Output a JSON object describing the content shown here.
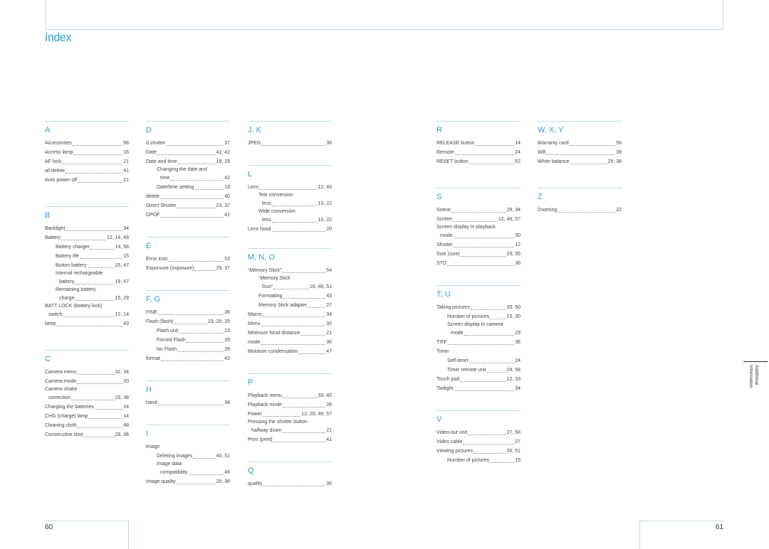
{
  "header": {
    "title": "Index"
  },
  "columns": [
    {
      "sections": [
        {
          "letter": "A",
          "entries": [
            {
              "label": "Accessories",
              "pages": "58"
            },
            {
              "label": "Access lamp",
              "pages": "16"
            },
            {
              "label": "AF lock",
              "pages": "21"
            },
            {
              "label": "all delete",
              "pages": "41"
            },
            {
              "label": "Auto power off",
              "pages": "21"
            }
          ]
        },
        {
          "letter": "B",
          "entries": [
            {
              "label": "Backlight",
              "pages": "34"
            },
            {
              "label": "Battery",
              "pages": "12, 14, 49"
            },
            {
              "label": "Battery charger",
              "pages": "14, 58",
              "sub": true
            },
            {
              "label": "Battery life",
              "pages": "15",
              "sub": true
            },
            {
              "label": "Button battery",
              "pages": "25, 47",
              "sub": true
            },
            {
              "label": "Internal rechargeable",
              "cont": "battery",
              "pages": "19, 47",
              "sub": true
            },
            {
              "label": "Remaining battery",
              "cont": "charge",
              "pages": "15, 29",
              "sub": true
            },
            {
              "label": "BATT LOCK (battery lock)",
              "cont": "switch",
              "pages": "12, 14"
            },
            {
              "label": "beep",
              "pages": "43"
            }
          ]
        },
        {
          "letter": "C",
          "entries": [
            {
              "label": "Camera menu",
              "pages": "32, 34"
            },
            {
              "label": "Camera mode",
              "pages": "20"
            },
            {
              "label": "Camera shake",
              "cont": "correction",
              "pages": "29, 38"
            },
            {
              "label": "Charging the batteries",
              "pages": "14"
            },
            {
              "label": "CHG (charge) lamp",
              "pages": "14"
            },
            {
              "label": "Cleaning cloth",
              "pages": "48"
            },
            {
              "label": "Consecutive shot",
              "pages": "29, 36"
            }
          ]
        }
      ]
    },
    {
      "sections": [
        {
          "letter": "D",
          "entries": [
            {
              "label": "d.shutter",
              "pages": "37"
            },
            {
              "label": "Date",
              "pages": "41, 42"
            },
            {
              "label": "Date and time",
              "pages": "18, 29"
            },
            {
              "label": "Changing the date and",
              "cont": "time",
              "pages": "42",
              "sub": true
            },
            {
              "label": "Date/time setting",
              "pages": "19",
              "sub": true
            },
            {
              "label": "delete",
              "pages": "40"
            },
            {
              "label": "Direct Shutter",
              "pages": "23, 37"
            },
            {
              "label": "DPOF",
              "pages": "41"
            }
          ]
        },
        {
          "letter": "E",
          "entries": [
            {
              "label": "Error icon",
              "pages": "53"
            },
            {
              "label": "Exporsure (exposure)",
              "pages": "29, 37"
            }
          ]
        },
        {
          "letter": "F, G",
          "entries": [
            {
              "label": "FINE",
              "pages": "36"
            },
            {
              "label": "Flash (flash)",
              "pages": "23, 29, 35"
            },
            {
              "label": "Flash unit",
              "pages": "23",
              "sub": true
            },
            {
              "label": "Forced Flash",
              "pages": "35",
              "sub": true
            },
            {
              "label": "No Flash",
              "pages": "35",
              "sub": true
            },
            {
              "label": "format",
              "pages": "43"
            }
          ]
        },
        {
          "letter": "H",
          "entries": [
            {
              "label": "hand",
              "pages": "38"
            }
          ]
        },
        {
          "letter": "I",
          "entries": [
            {
              "label": "Image",
              "pages": ""
            },
            {
              "label": "Deleting images",
              "pages": "40, 51",
              "sub": true
            },
            {
              "label": "Image data",
              "cont": "compatibility",
              "pages": "46",
              "sub": true
            },
            {
              "label": "Image quality",
              "pages": "29, 36"
            }
          ]
        }
      ]
    },
    {
      "sections": [
        {
          "letter": "J, K",
          "entries": [
            {
              "label": "JPEG",
              "pages": "36"
            }
          ]
        },
        {
          "letter": "L",
          "entries": [
            {
              "label": "Lens",
              "pages": "12, 46"
            },
            {
              "label": "Tele conversion",
              "cont": "lens",
              "pages": "13, 22",
              "sub": true
            },
            {
              "label": "Wide conversion",
              "cont": "lens",
              "pages": "13, 22",
              "sub": true
            },
            {
              "label": "Lens hood",
              "pages": "20"
            }
          ]
        },
        {
          "letter": "M, N, O",
          "entries": [
            {
              "label": "“Memory Stick”",
              "pages": "54"
            },
            {
              "label": "“Memory Stick",
              "cont": "Duo”",
              "pages": "16, 46, 51",
              "sub": true
            },
            {
              "label": "Formatting",
              "pages": "43",
              "sub": true
            },
            {
              "label": "Memory Stick adapter",
              "pages": "27",
              "sub": true
            },
            {
              "label": "Macro",
              "pages": "34"
            },
            {
              "label": "Menu",
              "pages": "32"
            },
            {
              "label": "Minimum focal distance",
              "pages": "21"
            },
            {
              "label": "mode",
              "pages": "36"
            },
            {
              "label": "Moisture condensation",
              "pages": "47"
            }
          ]
        },
        {
          "letter": "P",
          "entries": [
            {
              "label": "Playback menu",
              "pages": "33, 40"
            },
            {
              "label": "Playback mode",
              "pages": "26"
            },
            {
              "label": "Power",
              "pages": "12, 20, 49, 57"
            },
            {
              "label": "Pressing the shutter button",
              "cont": "halfway down",
              "pages": "21"
            },
            {
              "label": "Print (print)",
              "pages": "41"
            }
          ]
        },
        {
          "letter": "Q",
          "entries": [
            {
              "label": "quality",
              "pages": "36"
            }
          ]
        }
      ]
    },
    {
      "sections": [
        {
          "letter": "R",
          "entries": [
            {
              "label": "RELEASE button",
              "pages": "14"
            },
            {
              "label": "Remote",
              "pages": "24"
            },
            {
              "label": "RESET button",
              "pages": "52"
            }
          ]
        },
        {
          "letter": "S",
          "entries": [
            {
              "label": "Scene",
              "pages": "29, 34"
            },
            {
              "label": "Screen",
              "pages": "12, 46, 57"
            },
            {
              "label": "Screen display in playback",
              "cont": "mode",
              "pages": "30"
            },
            {
              "label": "Shutter",
              "pages": "12"
            },
            {
              "label": "Size (size)",
              "pages": "29, 35"
            },
            {
              "label": "STD",
              "pages": "36"
            }
          ]
        },
        {
          "letter": "T, U",
          "entries": [
            {
              "label": "Taking pictures",
              "pages": "20, 50"
            },
            {
              "label": "Number of pictures",
              "pages": "15, 30",
              "sub": true
            },
            {
              "label": "Screen display in camera",
              "cont": "mode",
              "pages": "29",
              "sub": true
            },
            {
              "label": "TIFF",
              "pages": "36"
            },
            {
              "label": "Timer",
              "pages": ""
            },
            {
              "label": "Self-timer",
              "pages": "24",
              "sub": true
            },
            {
              "label": "Timer remote unit",
              "pages": "24, 58",
              "sub": true
            },
            {
              "label": "Touch pad",
              "pages": "12, 33"
            },
            {
              "label": "Twilight",
              "pages": "34"
            }
          ]
        },
        {
          "letter": "V",
          "entries": [
            {
              "label": "Video-out unit",
              "pages": "27, 58"
            },
            {
              "label": "Video cable",
              "pages": "27"
            },
            {
              "label": "Viewing pictures",
              "pages": "26, 51"
            },
            {
              "label": "Number of pictures",
              "pages": "15",
              "sub": true
            }
          ]
        }
      ]
    },
    {
      "sections": [
        {
          "letter": "W, X, Y",
          "entries": [
            {
              "label": "Warranty card",
              "pages": "56"
            },
            {
              "label": "WB",
              "pages": "38"
            },
            {
              "label": "White balance",
              "pages": "29, 38"
            }
          ]
        },
        {
          "letter": "Z",
          "entries": [
            {
              "label": "Zooming",
              "pages": "22"
            }
          ]
        }
      ]
    }
  ],
  "side_tab": {
    "label": "Additional Information"
  },
  "footer": {
    "left_page": "60",
    "right_page": "61"
  }
}
